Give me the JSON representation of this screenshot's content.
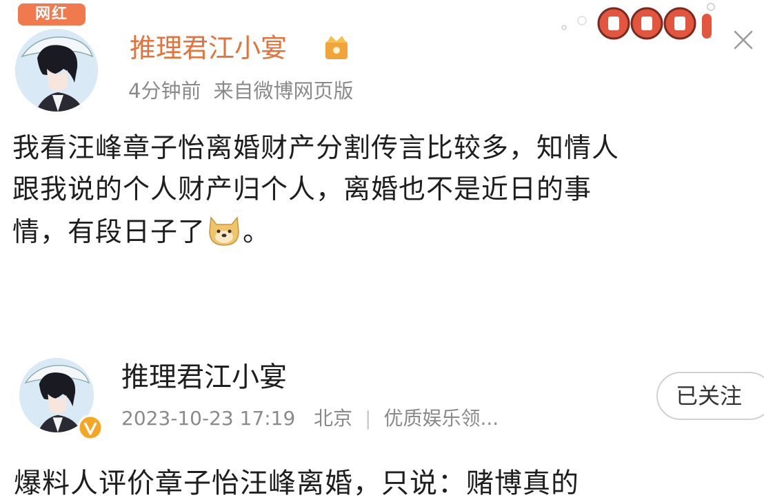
{
  "post1": {
    "tag": "网红",
    "author": "推理君江小宴",
    "time": "4分钟前",
    "source": "来自微博网页版",
    "line1": "我看汪峰章子怡离婚财产分割传言比较多，知情人",
    "line2": "跟我说的个人财产归个人，离婚也不是近日的事",
    "line3a": "情，有段日子了",
    "line3b": "。",
    "emoji": "doge-emoji"
  },
  "post2": {
    "author": "推理君江小宴",
    "datetime": "2023-10-23 17:19",
    "location": "北京",
    "separator": "|",
    "label": "优质娱乐领...",
    "follow_label": "已关注",
    "text": "爆料人评价章子怡汪峰离婚，只说：赌博真的"
  },
  "colors": {
    "author_orange": "#e5723d",
    "tag_bg": "#f07a4e",
    "meta_gray": "#8a8a8a",
    "text": "#1e1e1e",
    "verified": "#f5a623"
  }
}
